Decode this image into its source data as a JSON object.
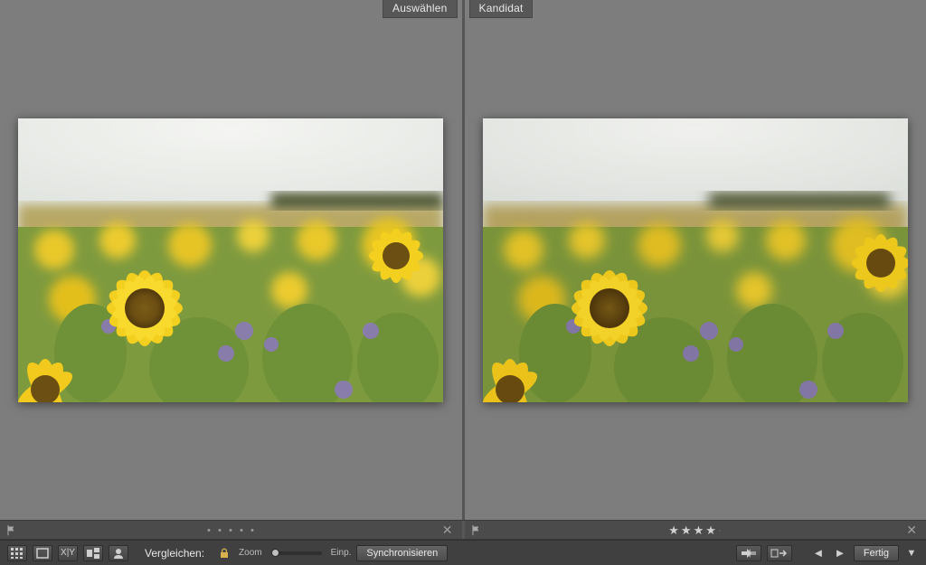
{
  "panes": {
    "left": {
      "label": "Auswählen",
      "rating": 0
    },
    "right": {
      "label": "Kandidat",
      "rating": 4
    }
  },
  "toolbar": {
    "compare_label": "Vergleichen:",
    "zoom_label": "Zoom",
    "fit_label": "Einp.",
    "sync_label": "Synchronisieren",
    "done_label": "Fertig",
    "icons": {
      "grid": "grid-view-icon",
      "loupe": "loupe-view-icon",
      "compare": "compare-view-icon",
      "survey": "survey-view-icon",
      "people": "people-view-icon",
      "lock": "lock-icon",
      "swap": "swap-icon",
      "make_select": "make-select-icon",
      "prev": "prev-photo-icon",
      "next": "next-photo-icon"
    }
  }
}
